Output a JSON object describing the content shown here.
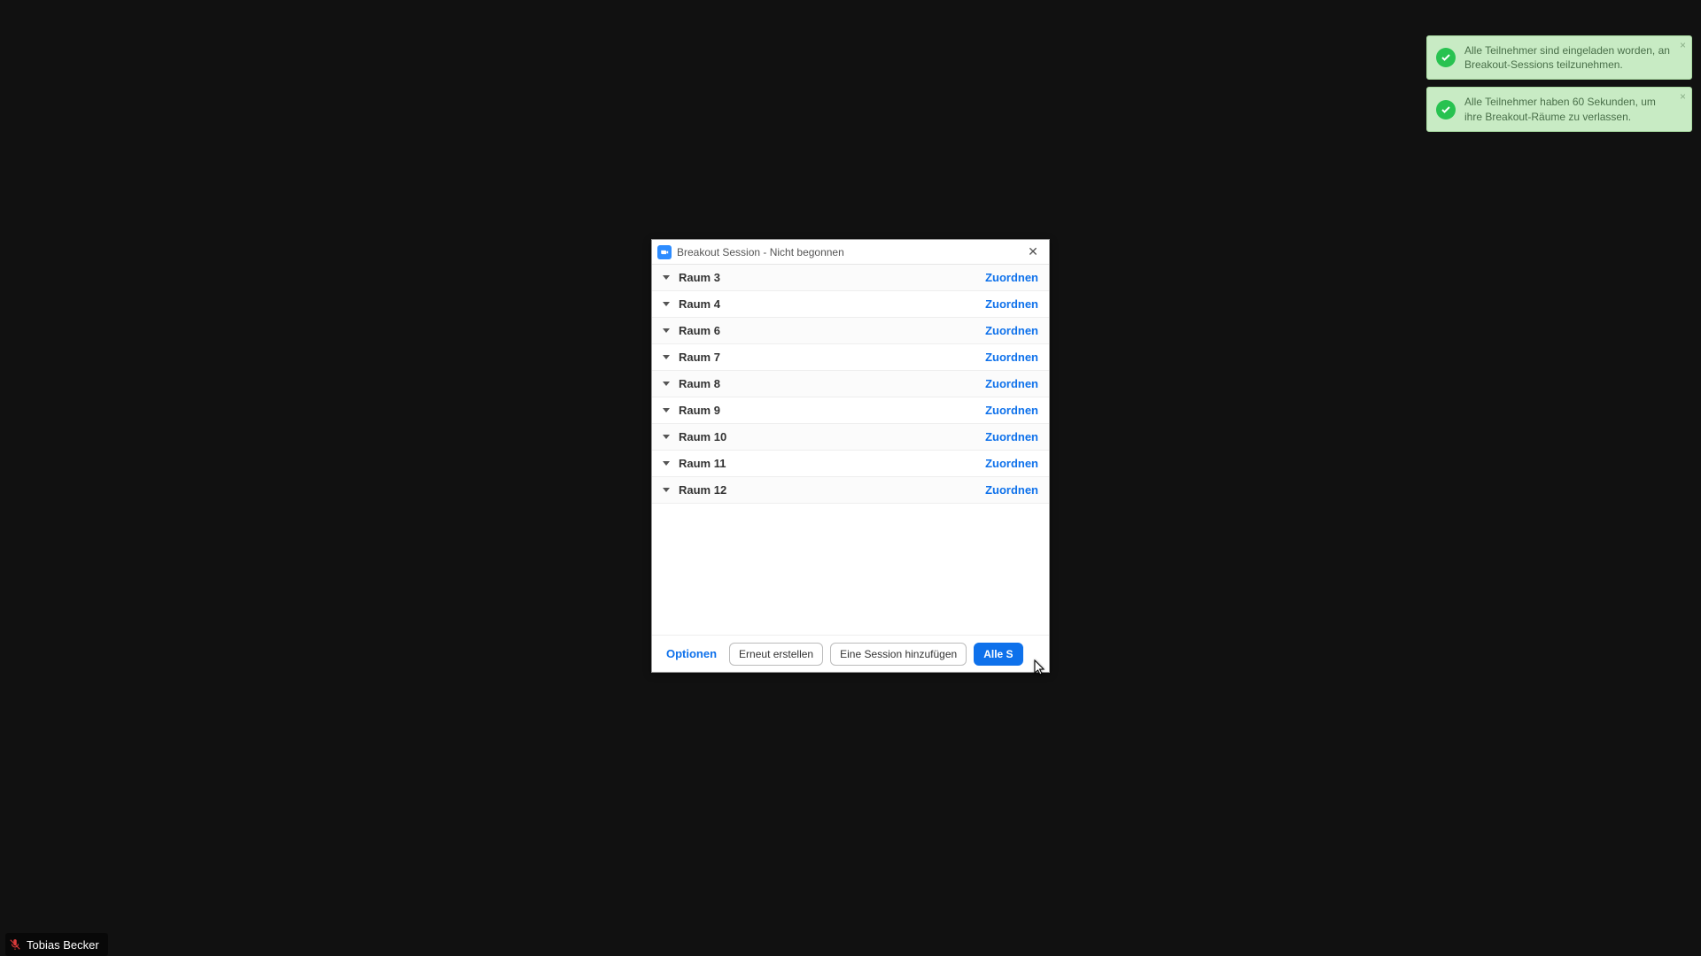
{
  "user": {
    "name": "Tobias Becker"
  },
  "toasts": [
    {
      "message": "Alle Teilnehmer sind eingeladen worden, an Breakout-Sessions teilzunehmen."
    },
    {
      "message": "Alle Teilnehmer haben 60 Sekunden, um ihre Breakout-Räume zu verlassen."
    }
  ],
  "dialog": {
    "title": "Breakout Session - Nicht begonnen",
    "assign_label": "Zuordnen",
    "rooms": [
      {
        "name": "Raum 3"
      },
      {
        "name": "Raum 4"
      },
      {
        "name": "Raum 6"
      },
      {
        "name": "Raum 7"
      },
      {
        "name": "Raum 8"
      },
      {
        "name": "Raum 9"
      },
      {
        "name": "Raum 10"
      },
      {
        "name": "Raum 11"
      },
      {
        "name": "Raum 12"
      }
    ],
    "footer": {
      "options": "Optionen",
      "recreate": "Erneut erstellen",
      "add_session": "Eine Session hinzufügen",
      "open_all": "Alle Sessionen starten",
      "open_all_visible": "Alle S"
    }
  }
}
